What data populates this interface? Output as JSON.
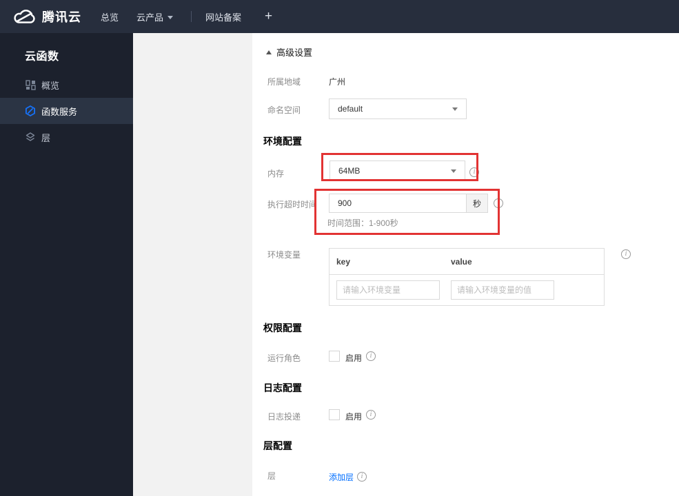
{
  "topnav": {
    "brand": "腾讯云",
    "overview": "总览",
    "products": "云产品",
    "beian": "网站备案",
    "plus": "+"
  },
  "sidebar": {
    "title": "云函数",
    "items": [
      {
        "label": "概览"
      },
      {
        "label": "函数服务"
      },
      {
        "label": "层"
      }
    ]
  },
  "content": {
    "advanced": "高级设置",
    "region_label": "所属地域",
    "region_value": "广州",
    "namespace_label": "命名空间",
    "namespace_value": "default",
    "env_title": "环境配置",
    "memory_label": "内存",
    "memory_value": "64MB",
    "timeout_label": "执行超时时间",
    "timeout_value": "900",
    "timeout_unit": "秒",
    "timeout_hint": "时间范围：1-900秒",
    "envvar_label": "环境变量",
    "envvar_key_header": "key",
    "envvar_value_header": "value",
    "envvar_key_placeholder": "请输入环境变量",
    "envvar_value_placeholder": "请输入环境变量的值",
    "perm_title": "权限配置",
    "role_label": "运行角色",
    "enable_label": "启用",
    "log_title": "日志配置",
    "log_label": "日志投递",
    "layer_title": "层配置",
    "layer_label": "层",
    "add_layer_link": "添加层",
    "info_glyph": "i"
  },
  "colors": {
    "accent_blue": "#006eff",
    "annotation_red": "#e23333",
    "nav_bg": "#272e3d",
    "sidebar_bg": "#1c212d",
    "sidebar_selected_bg": "#2b3444",
    "panel_gray": "#f2f2f2"
  }
}
